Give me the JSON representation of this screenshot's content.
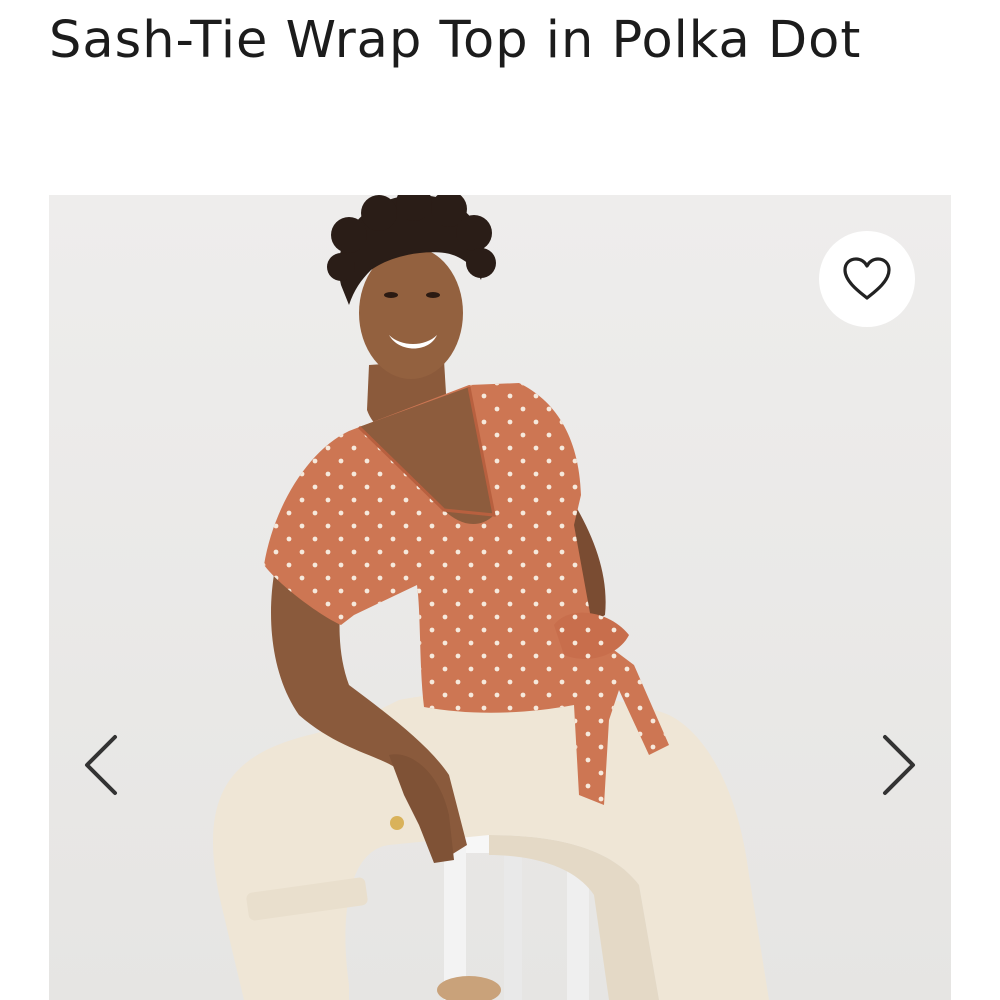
{
  "product": {
    "title": "Sash-Tie Wrap Top in Polka Dot"
  },
  "gallery": {
    "image_alt": "Model wearing sash-tie wrap top in polka dot",
    "favorite_icon": "heart-outline-icon",
    "prev_icon": "chevron-left-icon",
    "next_icon": "chevron-right-icon"
  },
  "colors": {
    "text": "#1c1c1c",
    "background": "#ffffff",
    "photo_backdrop": "#ecebea",
    "top_color": "#d07a58",
    "pants_color": "#efe6d6",
    "icon": "#222222"
  }
}
